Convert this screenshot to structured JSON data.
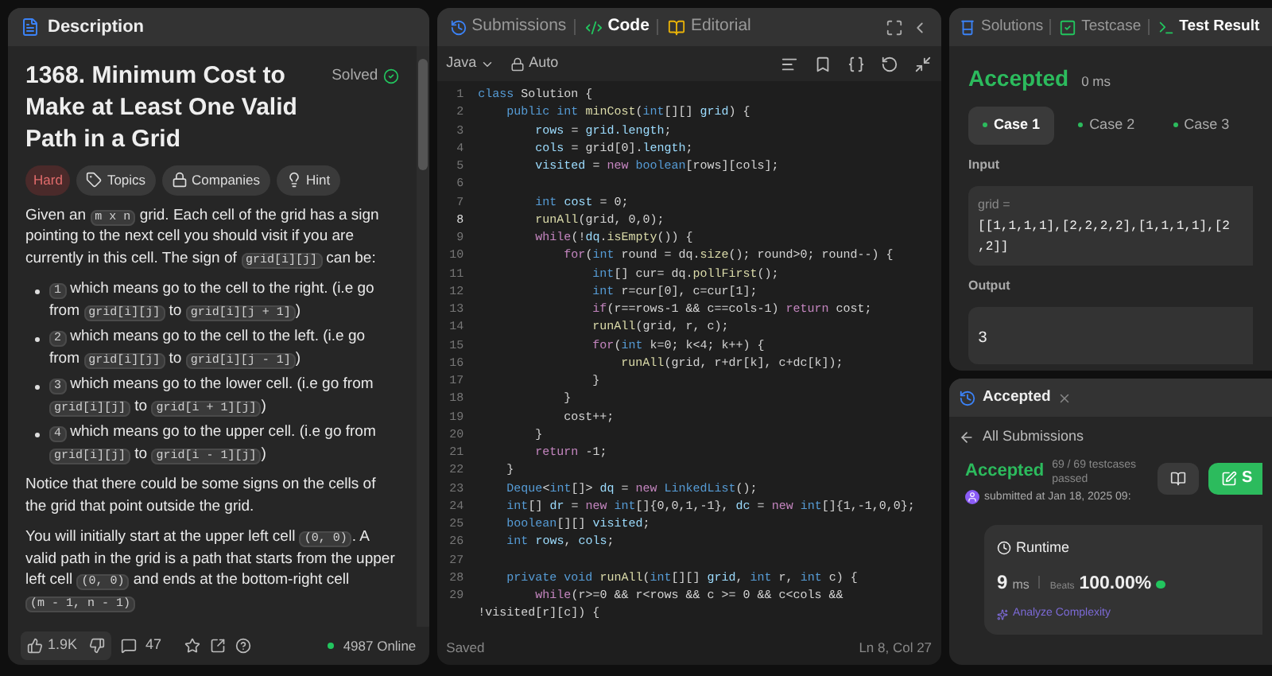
{
  "description_panel": {
    "tab": "Description",
    "title": "1368. Minimum Cost to Make at Least One Valid Path in a Grid",
    "status": "Solved",
    "tags": [
      {
        "kind": "difficulty",
        "label": "Hard"
      },
      {
        "kind": "topics",
        "label": "Topics"
      },
      {
        "kind": "companies",
        "label": "Companies"
      },
      {
        "kind": "hint",
        "label": "Hint"
      }
    ],
    "intro": [
      {
        "kind": "text",
        "text": "Given an "
      },
      {
        "kind": "code",
        "text": "m x n"
      },
      {
        "kind": "text",
        "text": " grid. Each cell of the grid has a sign pointing to the next cell you should visit if you are currently in this cell. The sign of "
      },
      {
        "kind": "code",
        "text": "grid[i][j]"
      },
      {
        "kind": "text",
        "text": " can be:"
      }
    ],
    "bullets": [
      [
        {
          "kind": "code",
          "text": "1"
        },
        {
          "kind": "text",
          "text": " which means go to the cell to the right. (i.e go from "
        },
        {
          "kind": "code",
          "text": "grid[i][j]"
        },
        {
          "kind": "text",
          "text": " to "
        },
        {
          "kind": "code",
          "text": "grid[i][j + 1]"
        },
        {
          "kind": "text",
          "text": ")"
        }
      ],
      [
        {
          "kind": "code",
          "text": "2"
        },
        {
          "kind": "text",
          "text": " which means go to the cell to the left. (i.e go from "
        },
        {
          "kind": "code",
          "text": "grid[i][j]"
        },
        {
          "kind": "text",
          "text": " to "
        },
        {
          "kind": "code",
          "text": "grid[i][j - 1]"
        },
        {
          "kind": "text",
          "text": ")"
        }
      ],
      [
        {
          "kind": "code",
          "text": "3"
        },
        {
          "kind": "text",
          "text": " which means go to the lower cell. (i.e go from "
        },
        {
          "kind": "code",
          "text": "grid[i][j]"
        },
        {
          "kind": "text",
          "text": " to "
        },
        {
          "kind": "code",
          "text": "grid[i + 1][j]"
        },
        {
          "kind": "text",
          "text": ")"
        }
      ],
      [
        {
          "kind": "code",
          "text": "4"
        },
        {
          "kind": "text",
          "text": " which means go to the upper cell. (i.e go from "
        },
        {
          "kind": "code",
          "text": "grid[i][j]"
        },
        {
          "kind": "text",
          "text": " to "
        },
        {
          "kind": "code",
          "text": "grid[i - 1][j]"
        },
        {
          "kind": "text",
          "text": ")"
        }
      ]
    ],
    "paragraphs": [
      [
        {
          "kind": "text",
          "text": "Notice that there could be some signs on the cells of the grid that point outside the grid."
        }
      ],
      [
        {
          "kind": "text",
          "text": "You will initially start at the upper left cell "
        },
        {
          "kind": "code",
          "text": "(0, 0)"
        },
        {
          "kind": "text",
          "text": ". A valid path in the grid is a path that starts from the upper left cell "
        },
        {
          "kind": "code",
          "text": "(0, 0)"
        },
        {
          "kind": "text",
          "text": " and ends at the bottom-right cell "
        },
        {
          "kind": "code",
          "text": "(m - 1, n - 1)"
        }
      ]
    ],
    "footer": {
      "likes": "1.9K",
      "comments": "47",
      "online": "4987 Online"
    }
  },
  "editor_panel": {
    "tabs": [
      {
        "label": "Submissions",
        "selected": false
      },
      {
        "label": "Code",
        "selected": true
      },
      {
        "label": "Editorial",
        "selected": false
      }
    ],
    "language": "Java",
    "mode": "Auto",
    "lines": [
      {
        "number": "1",
        "current": false,
        "tokens": [
          {
            "kind": "type",
            "text": "class "
          },
          {
            "kind": "plain",
            "text": "Solution {"
          }
        ]
      },
      {
        "number": "2",
        "current": false,
        "tokens": [
          {
            "kind": "type",
            "text": "    public int "
          },
          {
            "kind": "func",
            "text": "minCost"
          },
          {
            "kind": "plain",
            "text": "("
          },
          {
            "kind": "type",
            "text": "int"
          },
          {
            "kind": "plain",
            "text": "[][] "
          },
          {
            "kind": "var",
            "text": "grid"
          },
          {
            "kind": "plain",
            "text": ") {"
          }
        ]
      },
      {
        "number": "3",
        "current": false,
        "tokens": [
          {
            "kind": "var",
            "text": "        rows"
          },
          {
            "kind": "plain",
            "text": " = "
          },
          {
            "kind": "var",
            "text": "grid.length"
          },
          {
            "kind": "plain",
            "text": ";"
          }
        ]
      },
      {
        "number": "4",
        "current": false,
        "tokens": [
          {
            "kind": "var",
            "text": "        cols"
          },
          {
            "kind": "plain",
            "text": " = grid[0]."
          },
          {
            "kind": "var",
            "text": "length"
          },
          {
            "kind": "plain",
            "text": ";"
          }
        ]
      },
      {
        "number": "5",
        "current": false,
        "tokens": [
          {
            "kind": "var",
            "text": "        visited"
          },
          {
            "kind": "plain",
            "text": " = "
          },
          {
            "kind": "keyword",
            "text": "new "
          },
          {
            "kind": "type",
            "text": "boolean"
          },
          {
            "kind": "plain",
            "text": "[rows][cols];"
          }
        ]
      },
      {
        "number": "6",
        "current": false
      },
      {
        "number": "7",
        "current": false,
        "tokens": [
          {
            "kind": "type",
            "text": "        int "
          },
          {
            "kind": "var",
            "text": "cost"
          },
          {
            "kind": "plain",
            "text": " = 0;"
          }
        ]
      },
      {
        "number": "8",
        "current": true,
        "tokens": [
          {
            "kind": "func",
            "text": "        runAll"
          },
          {
            "kind": "plain",
            "text": "(grid, 0,0);"
          }
        ]
      },
      {
        "number": "9",
        "current": false,
        "tokens": [
          {
            "kind": "keyword",
            "text": "        while"
          },
          {
            "kind": "plain",
            "text": "(!"
          },
          {
            "kind": "var",
            "text": "dq"
          },
          {
            "kind": "plain",
            "text": "."
          },
          {
            "kind": "func",
            "text": "isEmpty"
          },
          {
            "kind": "plain",
            "text": "()) {"
          }
        ]
      },
      {
        "number": "10",
        "current": false,
        "tokens": [
          {
            "kind": "keyword",
            "text": "            for"
          },
          {
            "kind": "plain",
            "text": "("
          },
          {
            "kind": "type",
            "text": "int "
          },
          {
            "kind": "plain",
            "text": "round = dq."
          },
          {
            "kind": "func",
            "text": "size"
          },
          {
            "kind": "plain",
            "text": "(); round>0; round--) {"
          }
        ]
      },
      {
        "number": "11",
        "current": false,
        "tokens": [
          {
            "kind": "type",
            "text": "                int"
          },
          {
            "kind": "plain",
            "text": "[] cur= dq."
          },
          {
            "kind": "func",
            "text": "pollFirst"
          },
          {
            "kind": "plain",
            "text": "();"
          }
        ]
      },
      {
        "number": "12",
        "current": false,
        "tokens": [
          {
            "kind": "type",
            "text": "                int "
          },
          {
            "kind": "plain",
            "text": "r=cur[0], c=cur[1];"
          }
        ]
      },
      {
        "number": "13",
        "current": false,
        "tokens": [
          {
            "kind": "keyword",
            "text": "                if"
          },
          {
            "kind": "plain",
            "text": "(r==rows-1 && c==cols-1) "
          },
          {
            "kind": "keyword",
            "text": "return "
          },
          {
            "kind": "plain",
            "text": "cost;"
          }
        ]
      },
      {
        "number": "14",
        "current": false,
        "tokens": [
          {
            "kind": "func",
            "text": "                runAll"
          },
          {
            "kind": "plain",
            "text": "(grid, r, c);"
          }
        ]
      },
      {
        "number": "15",
        "current": false,
        "tokens": [
          {
            "kind": "keyword",
            "text": "                for"
          },
          {
            "kind": "plain",
            "text": "("
          },
          {
            "kind": "type",
            "text": "int "
          },
          {
            "kind": "plain",
            "text": "k=0; k<4; k++) {"
          }
        ]
      },
      {
        "number": "16",
        "current": false,
        "tokens": [
          {
            "kind": "func",
            "text": "                    runAll"
          },
          {
            "kind": "plain",
            "text": "(grid, r+dr[k], c+dc[k]);"
          }
        ]
      },
      {
        "number": "17",
        "current": false,
        "tokens": [
          {
            "kind": "plain",
            "text": "                }"
          }
        ]
      },
      {
        "number": "18",
        "current": false,
        "tokens": [
          {
            "kind": "plain",
            "text": "            }"
          }
        ]
      },
      {
        "number": "19",
        "current": false,
        "tokens": [
          {
            "kind": "plain",
            "text": "            cost++;"
          }
        ]
      },
      {
        "number": "20",
        "current": false,
        "tokens": [
          {
            "kind": "plain",
            "text": "        }"
          }
        ]
      },
      {
        "number": "21",
        "current": false,
        "tokens": [
          {
            "kind": "keyword",
            "text": "        return "
          },
          {
            "kind": "plain",
            "text": "-1;"
          }
        ]
      },
      {
        "number": "22",
        "current": false,
        "tokens": [
          {
            "kind": "plain",
            "text": "    }"
          }
        ]
      },
      {
        "number": "23",
        "current": false,
        "tokens": [
          {
            "kind": "type",
            "text": "    Deque"
          },
          {
            "kind": "plain",
            "text": "<"
          },
          {
            "kind": "type",
            "text": "int"
          },
          {
            "kind": "plain",
            "text": "[]> "
          },
          {
            "kind": "var",
            "text": "dq"
          },
          {
            "kind": "plain",
            "text": " = "
          },
          {
            "kind": "keyword",
            "text": "new "
          },
          {
            "kind": "type",
            "text": "LinkedList"
          },
          {
            "kind": "plain",
            "text": "();"
          }
        ]
      },
      {
        "number": "24",
        "current": false,
        "tokens": [
          {
            "kind": "type",
            "text": "    int"
          },
          {
            "kind": "plain",
            "text": "[] "
          },
          {
            "kind": "var",
            "text": "dr"
          },
          {
            "kind": "plain",
            "text": " = "
          },
          {
            "kind": "keyword",
            "text": "new "
          },
          {
            "kind": "type",
            "text": "int"
          },
          {
            "kind": "plain",
            "text": "[]{0,0,1,-1}, "
          },
          {
            "kind": "var",
            "text": "dc"
          },
          {
            "kind": "plain",
            "text": " = "
          },
          {
            "kind": "keyword",
            "text": "new "
          },
          {
            "kind": "type",
            "text": "int"
          },
          {
            "kind": "plain",
            "text": "[]{1,-1,0,0};"
          }
        ]
      },
      {
        "number": "25",
        "current": false,
        "tokens": [
          {
            "kind": "type",
            "text": "    boolean"
          },
          {
            "kind": "plain",
            "text": "[][] "
          },
          {
            "kind": "var",
            "text": "visited"
          },
          {
            "kind": "plain",
            "text": ";"
          }
        ]
      },
      {
        "number": "26",
        "current": false,
        "tokens": [
          {
            "kind": "type",
            "text": "    int "
          },
          {
            "kind": "var",
            "text": "rows"
          },
          {
            "kind": "plain",
            "text": ", "
          },
          {
            "kind": "var",
            "text": "cols"
          },
          {
            "kind": "plain",
            "text": ";"
          }
        ]
      },
      {
        "number": "27",
        "current": false
      },
      {
        "number": "28",
        "current": false,
        "tokens": [
          {
            "kind": "type",
            "text": "    private void "
          },
          {
            "kind": "func",
            "text": "runAll"
          },
          {
            "kind": "plain",
            "text": "("
          },
          {
            "kind": "type",
            "text": "int"
          },
          {
            "kind": "plain",
            "text": "[][] "
          },
          {
            "kind": "var",
            "text": "grid"
          },
          {
            "kind": "plain",
            "text": ", "
          },
          {
            "kind": "type",
            "text": "int "
          },
          {
            "kind": "plain",
            "text": "r, "
          },
          {
            "kind": "type",
            "text": "int "
          },
          {
            "kind": "plain",
            "text": "c) {"
          }
        ]
      },
      {
        "number": "29",
        "current": false,
        "tokens": [
          {
            "kind": "keyword",
            "text": "        while"
          },
          {
            "kind": "plain",
            "text": "(r>=0 && r<rows && c >= 0 && c<cols && !visited[r][c]) {"
          }
        ]
      }
    ],
    "status": "Saved",
    "cursor": "Ln 8, Col 27"
  },
  "result_panel": {
    "tabs": [
      {
        "label": "Solutions",
        "selected": false
      },
      {
        "label": "Testcase",
        "selected": false
      },
      {
        "label": "Test Result",
        "selected": true
      }
    ],
    "verdict": "Accepted",
    "time": "0 ms",
    "cases": [
      {
        "label": "Case 1",
        "selected": true
      },
      {
        "label": "Case 2",
        "selected": false
      },
      {
        "label": "Case 3",
        "selected": false
      }
    ],
    "input_label": "Input",
    "input_name": "grid =",
    "input_lines": [
      "[[1,1,1,1],[2,2,2,2],[1,1,1,1],[2",
      ",2]]"
    ],
    "output_label": "Output",
    "output": "3"
  },
  "submission_panel": {
    "tab": "Accepted",
    "back": "All Submissions",
    "verdict": "Accepted",
    "passed": "69 / 69 testcases passed",
    "submitted": "submitted at Jan 18, 2025 09:",
    "action": "S",
    "runtime_label": "Runtime",
    "runtime_value": "9",
    "runtime_unit": "ms",
    "beats_label": "Beats",
    "beats_value": "100.00%",
    "analyze": "Analyze Complexity"
  }
}
